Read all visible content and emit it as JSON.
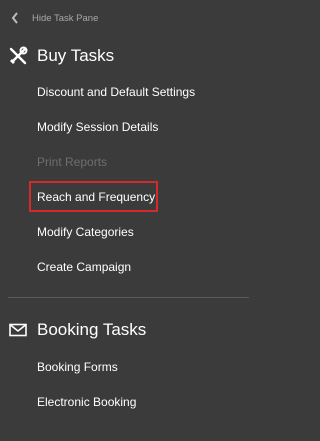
{
  "hide_pane": {
    "label": "Hide Task Pane",
    "icon": "chevron-left-icon"
  },
  "buy_tasks": {
    "title": "Buy Tasks",
    "icon": "tools-icon",
    "items": [
      {
        "label": "Discount and Default Settings",
        "enabled": true
      },
      {
        "label": "Modify Session Details",
        "enabled": true
      },
      {
        "label": "Print Reports",
        "enabled": false
      },
      {
        "label": "Reach and Frequency",
        "enabled": true,
        "highlighted": true
      },
      {
        "label": "Modify Categories",
        "enabled": true
      },
      {
        "label": "Create Campaign",
        "enabled": true
      }
    ]
  },
  "booking_tasks": {
    "title": "Booking Tasks",
    "icon": "envelope-icon",
    "items": [
      {
        "label": "Booking Forms",
        "enabled": true
      },
      {
        "label": "Electronic Booking",
        "enabled": true
      }
    ]
  },
  "colors": {
    "background": "#3b3b3b",
    "text": "#ffffff",
    "disabled_text": "#6e6e6e",
    "highlight_border": "#d42a2a"
  }
}
